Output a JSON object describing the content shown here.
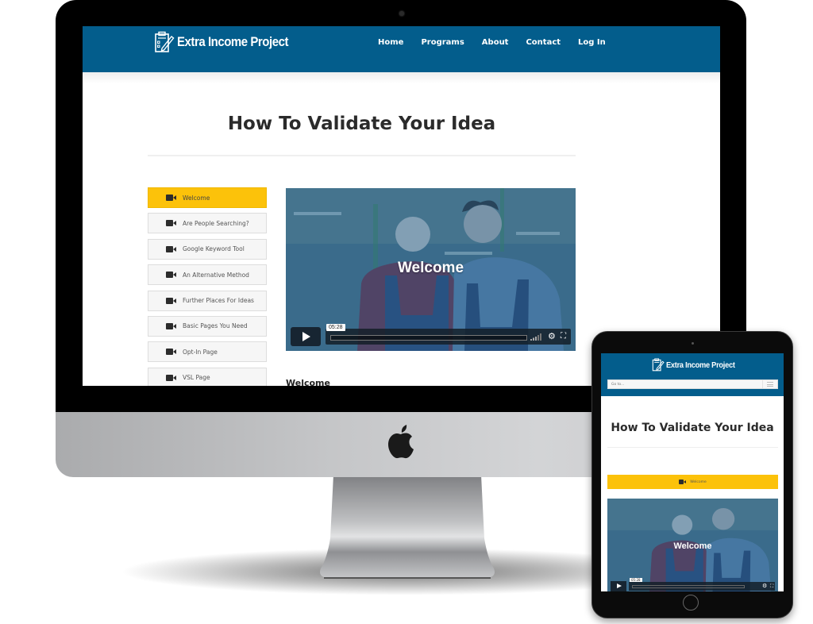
{
  "site": {
    "brand": "Extra Income Project",
    "nav": [
      "Home",
      "Programs",
      "About",
      "Contact",
      "Log In"
    ],
    "page_title": "How To Validate Your Idea",
    "lessons": [
      {
        "label": "Welcome",
        "active": true
      },
      {
        "label": "Are People Searching?",
        "active": false
      },
      {
        "label": "Google Keyword Tool",
        "active": false
      },
      {
        "label": "An Alternative Method",
        "active": false
      },
      {
        "label": "Further Places For Ideas",
        "active": false
      },
      {
        "label": "Basic Pages You Need",
        "active": false
      },
      {
        "label": "Opt-In Page",
        "active": false
      },
      {
        "label": "VSL Page",
        "active": false
      }
    ],
    "video": {
      "title": "Welcome",
      "duration": "05:28",
      "controls": [
        "play-icon",
        "volume-icon",
        "settings-gear-icon",
        "fullscreen-icon"
      ]
    },
    "section_heading": "Welcome"
  },
  "mobile": {
    "brand": "Extra Income Project",
    "menu_placeholder": "Go to...",
    "page_title": "How To Validate Your Idea",
    "active_lesson": "Welcome",
    "video": {
      "title": "Welcome",
      "duration": "05:28"
    }
  },
  "colors": {
    "header_blue": "#035d8c",
    "active_yellow": "#fcc20a",
    "title_text": "#2b2b2b"
  }
}
